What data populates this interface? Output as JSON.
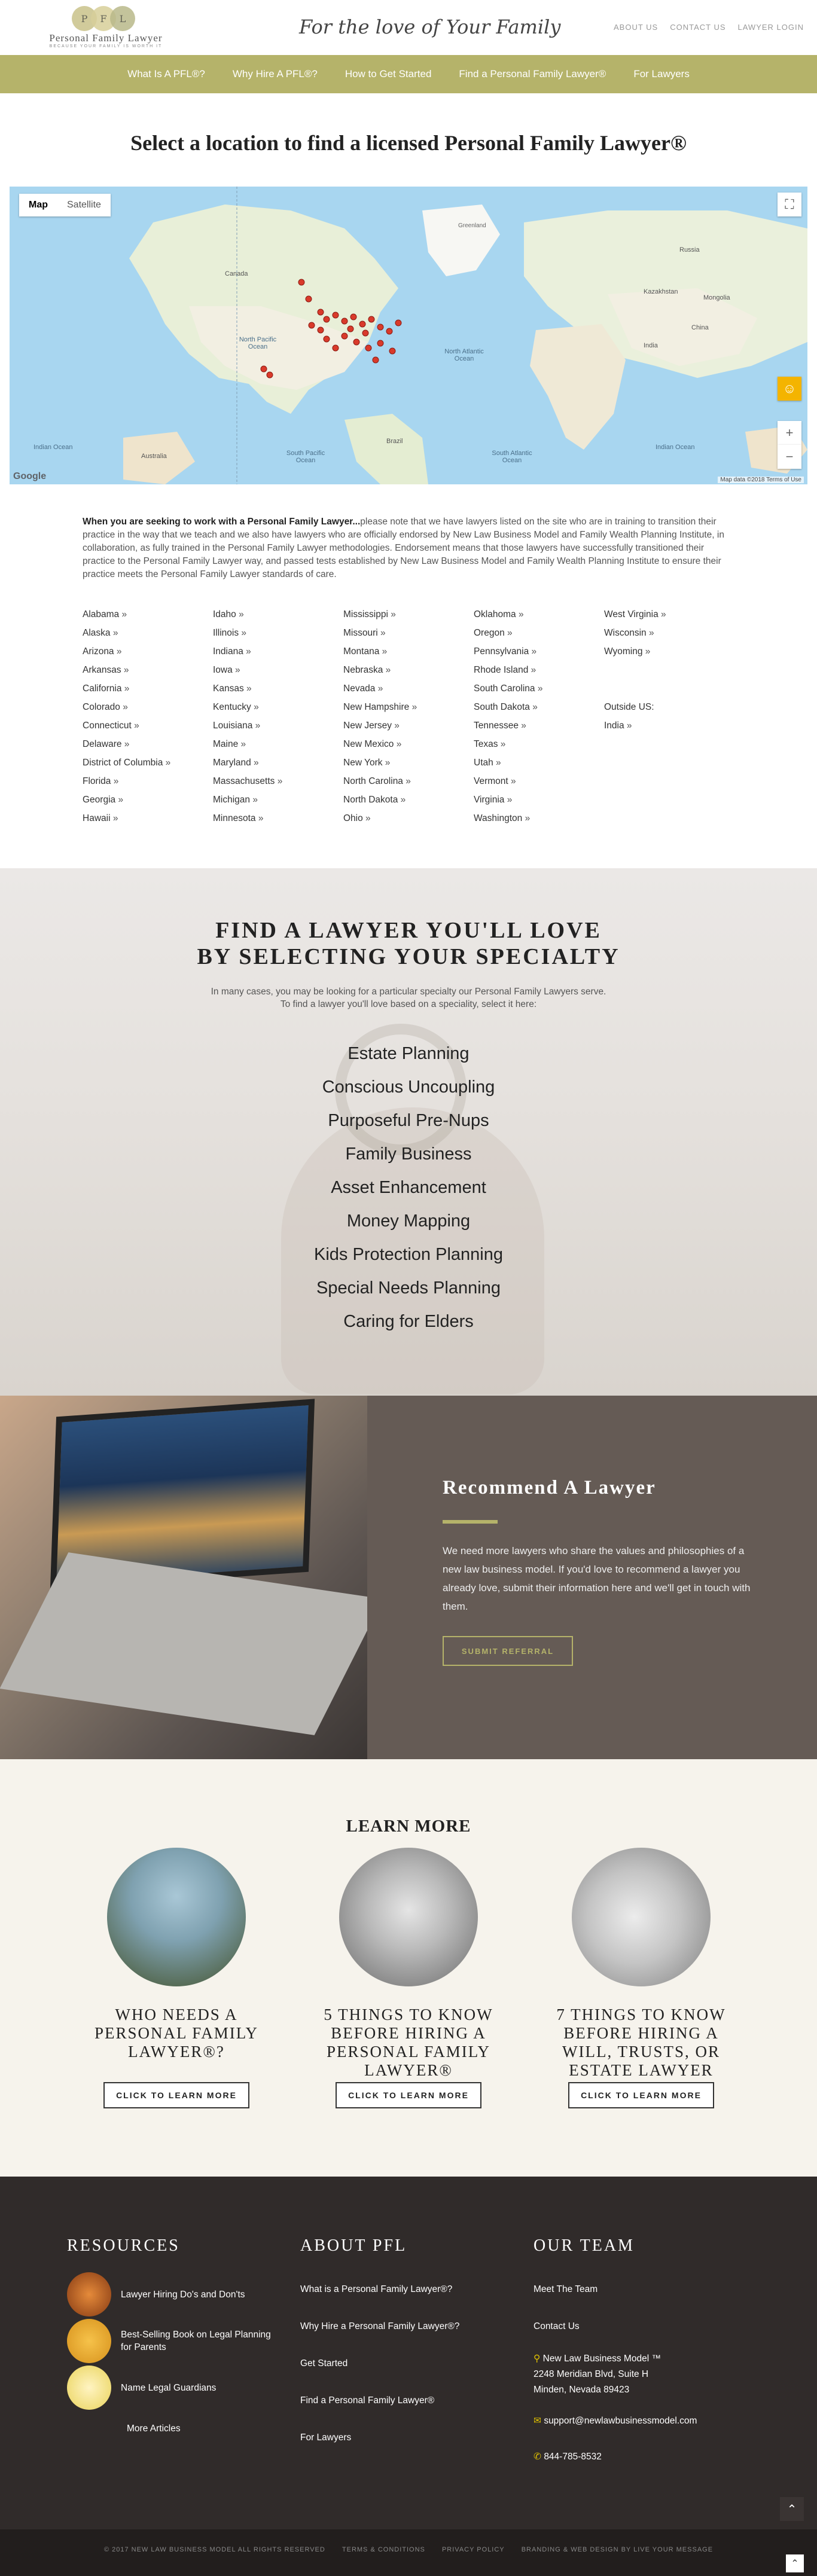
{
  "header": {
    "logo_initials": "PFL",
    "logo_name": "Personal Family Lawyer",
    "logo_tagline": "BECAUSE YOUR FAMILY IS WORTH IT",
    "tagline": "For the love of Your Family",
    "top_links": [
      "ABOUT US",
      "CONTACT US",
      "LAWYER LOGIN"
    ]
  },
  "nav": [
    "What Is A PFL®?",
    "Why Hire A PFL®?",
    "How to Get Started",
    "Find a Personal Family Lawyer®",
    "For Lawyers"
  ],
  "map_section": {
    "title": "Select a location to find a licensed Personal Family Lawyer®",
    "map_tab_map": "Map",
    "map_tab_satellite": "Satellite",
    "google_label": "Google",
    "credit": "Map data ©2018   Terms of Use",
    "labels": [
      "Greenland",
      "North Pacific Ocean",
      "North Atlantic Ocean",
      "South Pacific Ocean",
      "South Atlantic Ocean",
      "Indian Ocean",
      "Indian Ocean",
      "Australia",
      "Brazil",
      "Russia",
      "China",
      "India",
      "Canada",
      "Mongolia",
      "Kazakhstan"
    ]
  },
  "intro": {
    "bold": "When you are seeking to work with a Personal Family Lawyer...",
    "text": "please note that we have lawyers listed on the site who are in training to transition their practice in the way that we teach and we also have lawyers who are officially endorsed by New Law Business Model and Family Wealth Planning Institute, in collaboration, as fully trained in the Personal Family Lawyer methodologies. Endorsement means that those lawyers have successfully transitioned their practice to the Personal Family Lawyer way, and passed tests established by New Law Business Model and Family Wealth Planning Institute to ensure their practice meets the Personal Family Lawyer standards of care."
  },
  "states": {
    "col1": [
      "Alabama",
      "Alaska",
      "Arizona",
      "Arkansas",
      "California",
      "Colorado",
      "Connecticut",
      "Delaware",
      "District of Columbia",
      "Florida",
      "Georgia",
      "Hawaii"
    ],
    "col2": [
      "Idaho",
      "Illinois",
      "Indiana",
      "Iowa",
      "Kansas",
      "Kentucky",
      "Louisiana",
      "Maine",
      "Maryland",
      "Massachusetts",
      "Michigan",
      "Minnesota"
    ],
    "col3": [
      "Mississippi",
      "Missouri",
      "Montana",
      "Nebraska",
      "Nevada",
      "New Hampshire",
      "New Jersey",
      "New Mexico",
      "New York",
      "North Carolina",
      "North Dakota",
      "Ohio"
    ],
    "col4": [
      "Oklahoma",
      "Oregon",
      "Pennsylvania",
      "Rhode Island",
      "South Carolina",
      "South Dakota",
      "Tennessee",
      "Texas",
      "Utah",
      "Vermont",
      "Virginia",
      "Washington"
    ],
    "col5": [
      "West Virginia",
      "Wisconsin",
      "Wyoming"
    ],
    "outside_label": "Outside US:",
    "outside": [
      "India"
    ]
  },
  "specialty": {
    "title_line1": "FIND A LAWYER YOU'LL LOVE",
    "title_line2": "BY SELECTING YOUR SPECIALTY",
    "sub_line1": "In many cases, you may be looking for a particular specialty our Personal Family Lawyers serve.",
    "sub_line2": "To find a lawyer you'll love based on a speciality, select it here:",
    "items": [
      "Estate Planning",
      "Conscious Uncoupling",
      "Purposeful Pre-Nups",
      "Family Business",
      "Asset Enhancement",
      "Money Mapping",
      "Kids Protection Planning",
      "Special Needs Planning",
      "Caring for Elders"
    ]
  },
  "recommend": {
    "title": "Recommend A Lawyer",
    "text": "We need more lawyers who share the values and philosophies of a new law business model. If you'd love to recommend a lawyer you already love, submit their information here and we'll get in touch with them.",
    "button": "SUBMIT REFERRAL"
  },
  "learn": {
    "title": "LEARN MORE",
    "cards": [
      {
        "title": "WHO NEEDS A PERSONAL FAMILY LAWYER®?",
        "button": "CLICK TO LEARN MORE"
      },
      {
        "title": "5 THINGS TO KNOW BEFORE HIRING A PERSONAL FAMILY LAWYER®",
        "button": "CLICK TO LEARN MORE"
      },
      {
        "title": "7 THINGS TO KNOW BEFORE HIRING A WILL, TRUSTS, OR ESTATE LAWYER",
        "button": "CLICK TO LEARN MORE"
      }
    ]
  },
  "footer": {
    "resources_title": "RESOURCES",
    "resources": [
      "Lawyer Hiring Do's and Don'ts",
      "Best-Selling Book on Legal Planning for Parents",
      "Name Legal Guardians"
    ],
    "more_articles": "More Articles",
    "about_title": "ABOUT PFL",
    "about_links": [
      "What is a Personal Family Lawyer®?",
      "Why Hire a Personal Family Lawyer®?",
      "Get Started",
      "Find a Personal Family Lawyer®",
      "For Lawyers"
    ],
    "team_title": "OUR TEAM",
    "team_links": [
      "Meet The Team",
      "Contact Us"
    ],
    "company": "New Law Business Model ™",
    "address1": "2248 Meridian Blvd, Suite H",
    "address2": "Minden, Nevada 89423",
    "email": "support@newlawbusinessmodel.com",
    "phone": "844-785-8532",
    "bottom": [
      "© 2017 NEW LAW BUSINESS MODEL ALL RIGHTS RESERVED",
      "TERMS & CONDITIONS",
      "PRIVACY POLICY",
      "BRANDING & WEB DESIGN BY LIVE YOUR MESSAGE"
    ]
  },
  "colors": {
    "accent": "#b5b36a",
    "footer": "#302b2a",
    "panel": "#655b55"
  }
}
